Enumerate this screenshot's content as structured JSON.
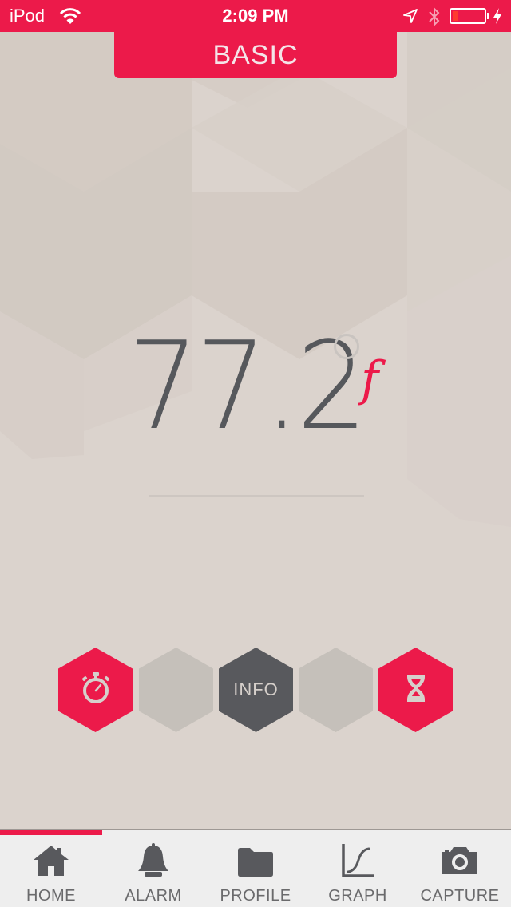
{
  "status_bar": {
    "carrier": "iPod",
    "time": "2:09 PM",
    "icons": [
      "wifi-icon",
      "location-icon",
      "bluetooth-icon",
      "battery-icon",
      "charging-icon"
    ],
    "battery_level_fraction": 0.15
  },
  "mode_tab": {
    "label": "BASIC"
  },
  "reading": {
    "value": "77.2",
    "degree_symbol": "degree-ring",
    "unit": "f"
  },
  "hex_buttons": [
    {
      "icon": "stopwatch-icon",
      "label": "",
      "style": "red"
    },
    {
      "icon": "",
      "label": "",
      "style": "grey"
    },
    {
      "icon": "",
      "label": "INFO",
      "style": "dark"
    },
    {
      "icon": "",
      "label": "",
      "style": "grey"
    },
    {
      "icon": "hourglass-icon",
      "label": "",
      "style": "red"
    }
  ],
  "tab_bar": {
    "active_index": 0,
    "items": [
      {
        "label": "HOME",
        "icon": "home-icon"
      },
      {
        "label": "ALARM",
        "icon": "bell-icon"
      },
      {
        "label": "PROFILE",
        "icon": "folder-icon"
      },
      {
        "label": "GRAPH",
        "icon": "graph-icon"
      },
      {
        "label": "CAPTURE",
        "icon": "camera-icon"
      }
    ]
  },
  "colors": {
    "accent": "#ec1a4a",
    "dark": "#58595d",
    "grey_hex": "#c5c0ba",
    "background": "#dbd3cd",
    "tab_bar_bg": "#eeeeee"
  }
}
